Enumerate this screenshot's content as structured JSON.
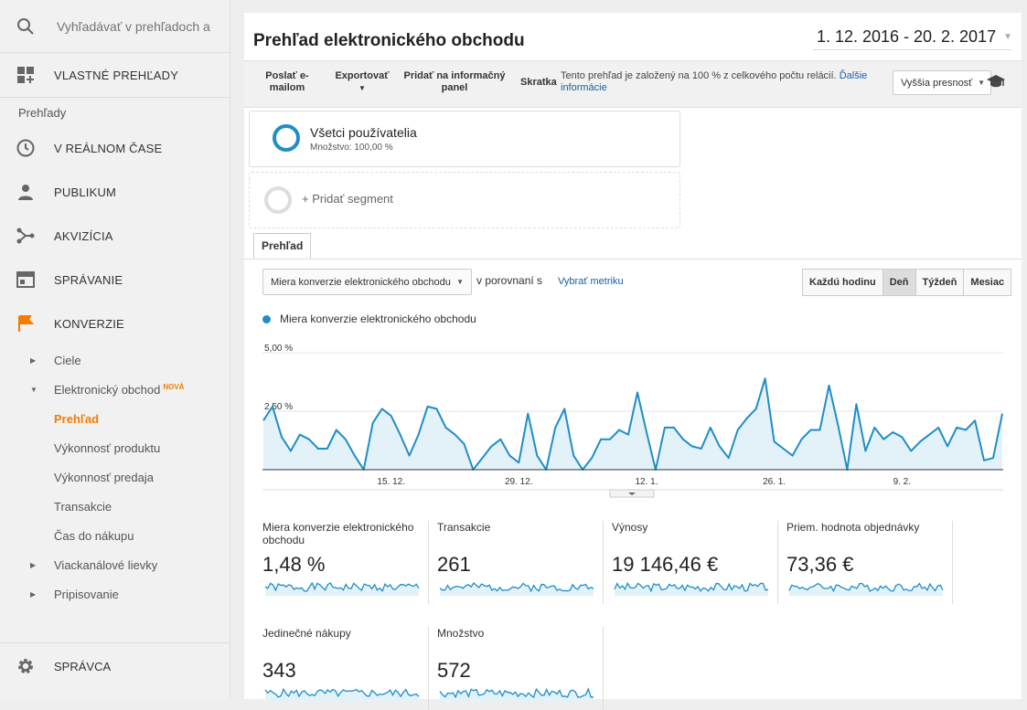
{
  "sidebar": {
    "search_placeholder": "Vyhľadávať v prehľadoch a",
    "custom_reports": "VLASTNÉ PREHĽADY",
    "reports_heading": "Prehľady",
    "items": [
      {
        "label": "V REÁLNOM ČASE",
        "icon": "clock-icon"
      },
      {
        "label": "PUBLIKUM",
        "icon": "person-icon"
      },
      {
        "label": "AKVIZÍCIA",
        "icon": "acquisition-icon"
      },
      {
        "label": "SPRÁVANIE",
        "icon": "behavior-icon"
      },
      {
        "label": "KONVERZIE",
        "icon": "flag-icon"
      }
    ],
    "sub": {
      "ciele": "Ciele",
      "ecommerce": "Elektronický obchod",
      "nova": "NOVÁ",
      "prehlad": "Prehľad",
      "vykonnost_produktu": "Výkonnosť produktu",
      "vykonnost_predaja": "Výkonnosť predaja",
      "transakcie": "Transakcie",
      "cas": "Čas do nákupu",
      "viackanalove": "Viackanálové lievky",
      "pripisovanie": "Pripisovanie"
    },
    "admin": "SPRÁVCA"
  },
  "header": {
    "title": "Prehľad elektronického obchodu",
    "date_range": "1. 12. 2016 - 20. 2. 2017"
  },
  "toolbar": {
    "email": "Poslať e-mailom",
    "export": "Exportovať",
    "add_dashboard": "Pridať na informačný panel",
    "shortcut": "Skratka",
    "info_text": "Tento prehľad je založený na 100 % z celkového počtu relácií.",
    "info_link": "Ďalšie informácie",
    "precision": "Vyššia presnosť"
  },
  "segments": {
    "all_users": "Všetci používatelia",
    "all_users_sub": "Množstvo: 100,00 %",
    "add_segment": "+ Pridať segment"
  },
  "tabs": {
    "overview": "Prehľad"
  },
  "controls": {
    "metric": "Miera konverzie elektronického obchodu",
    "compare": "v porovnaní s",
    "choose_metric": "Vybrať metriku",
    "periods": [
      "Každú hodinu",
      "Deň",
      "Týždeň",
      "Mesiac"
    ],
    "selected_period": "Deň"
  },
  "chart_data": {
    "type": "area",
    "series_name": "Miera konverzie elektronického obchodu",
    "color": "#1f8ec7",
    "ylabels": [
      "5,00 %",
      "2,50 %"
    ],
    "ylim": [
      0,
      5
    ],
    "xticks": [
      "15. 12.",
      "29. 12.",
      "12. 1.",
      "26. 1.",
      "9. 2."
    ],
    "xtick_day_index": [
      14,
      28,
      42,
      56,
      70
    ],
    "values": [
      2.1,
      2.7,
      1.4,
      0.8,
      1.5,
      1.3,
      0.9,
      0.9,
      1.7,
      1.3,
      0.6,
      0.0,
      2.0,
      2.6,
      2.3,
      1.5,
      0.6,
      1.5,
      2.7,
      2.6,
      1.8,
      1.5,
      1.1,
      0.0,
      0.5,
      1.0,
      1.3,
      0.6,
      0.3,
      2.4,
      0.6,
      0.0,
      1.8,
      2.6,
      0.6,
      0.0,
      0.5,
      1.3,
      1.3,
      1.7,
      1.5,
      3.3,
      1.6,
      0.0,
      1.8,
      1.8,
      1.3,
      1.0,
      0.9,
      1.8,
      1.0,
      0.5,
      1.7,
      2.2,
      2.6,
      3.9,
      1.2,
      0.9,
      0.6,
      1.3,
      1.7,
      1.7,
      3.6,
      1.9,
      0.0,
      2.8,
      0.8,
      1.8,
      1.3,
      1.6,
      1.4,
      0.8,
      1.2,
      1.5,
      1.8,
      1.0,
      1.8,
      1.7,
      2.1,
      0.4,
      0.5,
      2.4
    ]
  },
  "kpis": [
    {
      "label": "Miera konverzie elektronického obchodu",
      "value": "1,48 %"
    },
    {
      "label": "Transakcie",
      "value": "261"
    },
    {
      "label": "Výnosy",
      "value": "19 146,46 €"
    },
    {
      "label": "Priem. hodnota objednávky",
      "value": "73,36 €"
    },
    {
      "label": "Jedinečné nákupy",
      "value": "343"
    },
    {
      "label": "Množstvo",
      "value": "572"
    }
  ]
}
